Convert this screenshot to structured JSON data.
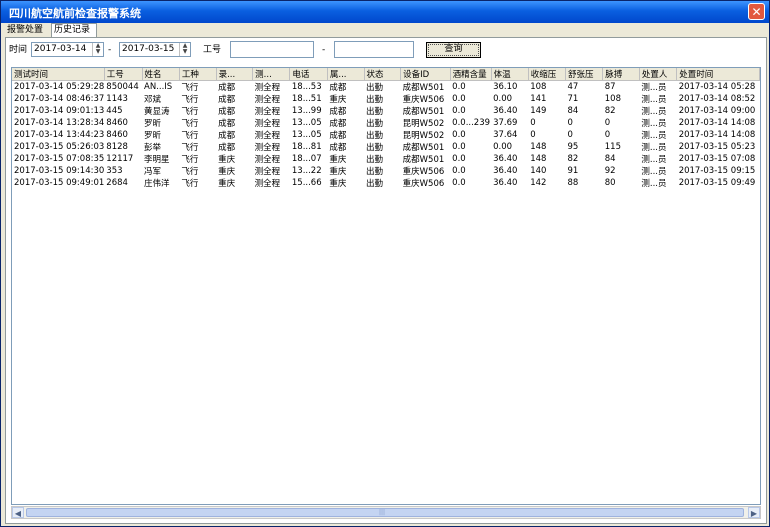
{
  "window": {
    "title": "四川航空航前检查报警系统",
    "close_glyph": "✕"
  },
  "tabs": [
    {
      "label": "报警处置"
    },
    {
      "label": "历史记录"
    }
  ],
  "filter": {
    "time_label": "时间",
    "start_date": "2017-03-14",
    "separator": "-",
    "end_date": "2017-03-15",
    "employee_label": "工号",
    "range_sep": "-",
    "emp_from": "",
    "emp_to": "",
    "query_label": "查询",
    "spin_up": "▲",
    "spin_down": "▼"
  },
  "table": {
    "columns": [
      "测试时间",
      "工号",
      "姓名",
      "工种",
      "录...",
      "测...",
      "电话",
      "属...",
      "状态",
      "设备ID",
      "酒精含量",
      "体温",
      "收缩压",
      "舒张压",
      "脉搏",
      "处置人",
      "处置时间"
    ],
    "rows": [
      [
        "2017-03-14 05:29:28",
        "850044",
        "AN...IS",
        "飞行",
        "成都",
        "测全程",
        "18...53",
        "成都",
        "出勤",
        "成都W501",
        "0.0",
        "36.10",
        "108",
        "47",
        "87",
        "测...员",
        "2017-03-14 05:28"
      ],
      [
        "2017-03-14 08:46:37",
        "1143",
        "邓斌",
        "飞行",
        "成都",
        "测全程",
        "18...51",
        "重庆",
        "出勤",
        "重庆W506",
        "0.0",
        "0.00",
        "141",
        "71",
        "108",
        "测...员",
        "2017-03-14 08:52"
      ],
      [
        "2017-03-14 09:01:13",
        "445",
        "黄显涛",
        "飞行",
        "成都",
        "测全程",
        "13...99",
        "成都",
        "出勤",
        "成都W501",
        "0.0",
        "36.40",
        "149",
        "84",
        "82",
        "测...员",
        "2017-03-14 09:00"
      ],
      [
        "2017-03-14 13:28:34",
        "8460",
        "罗昕",
        "飞行",
        "成都",
        "测全程",
        "13...05",
        "成都",
        "出勤",
        "昆明W502",
        "0.0...239",
        "37.69",
        "0",
        "0",
        "0",
        "测...员",
        "2017-03-14 14:08"
      ],
      [
        "2017-03-14 13:44:23",
        "8460",
        "罗昕",
        "飞行",
        "成都",
        "测全程",
        "13...05",
        "成都",
        "出勤",
        "昆明W502",
        "0.0",
        "37.64",
        "0",
        "0",
        "0",
        "测...员",
        "2017-03-14 14:08"
      ],
      [
        "2017-03-15 05:26:03",
        "8128",
        "彭举",
        "飞行",
        "成都",
        "测全程",
        "18...81",
        "成都",
        "出勤",
        "成都W501",
        "0.0",
        "0.00",
        "148",
        "95",
        "115",
        "测...员",
        "2017-03-15 05:23"
      ],
      [
        "2017-03-15 07:08:35",
        "12117",
        "李明星",
        "飞行",
        "重庆",
        "测全程",
        "18...07",
        "重庆",
        "出勤",
        "成都W501",
        "0.0",
        "36.40",
        "148",
        "82",
        "84",
        "测...员",
        "2017-03-15 07:08"
      ],
      [
        "2017-03-15 09:14:30",
        "353",
        "冯军",
        "飞行",
        "重庆",
        "测全程",
        "13...22",
        "重庆",
        "出勤",
        "重庆W506",
        "0.0",
        "36.40",
        "140",
        "91",
        "92",
        "测...员",
        "2017-03-15 09:15"
      ],
      [
        "2017-03-15 09:49:01",
        "2684",
        "庄伟洋",
        "飞行",
        "重庆",
        "测全程",
        "15...66",
        "重庆",
        "出勤",
        "重庆W506",
        "0.0",
        "36.40",
        "142",
        "88",
        "80",
        "测...员",
        "2017-03-15 09:49"
      ]
    ]
  },
  "scrollbar": {
    "left": "◀",
    "right": "▶",
    "grip": "|||"
  }
}
